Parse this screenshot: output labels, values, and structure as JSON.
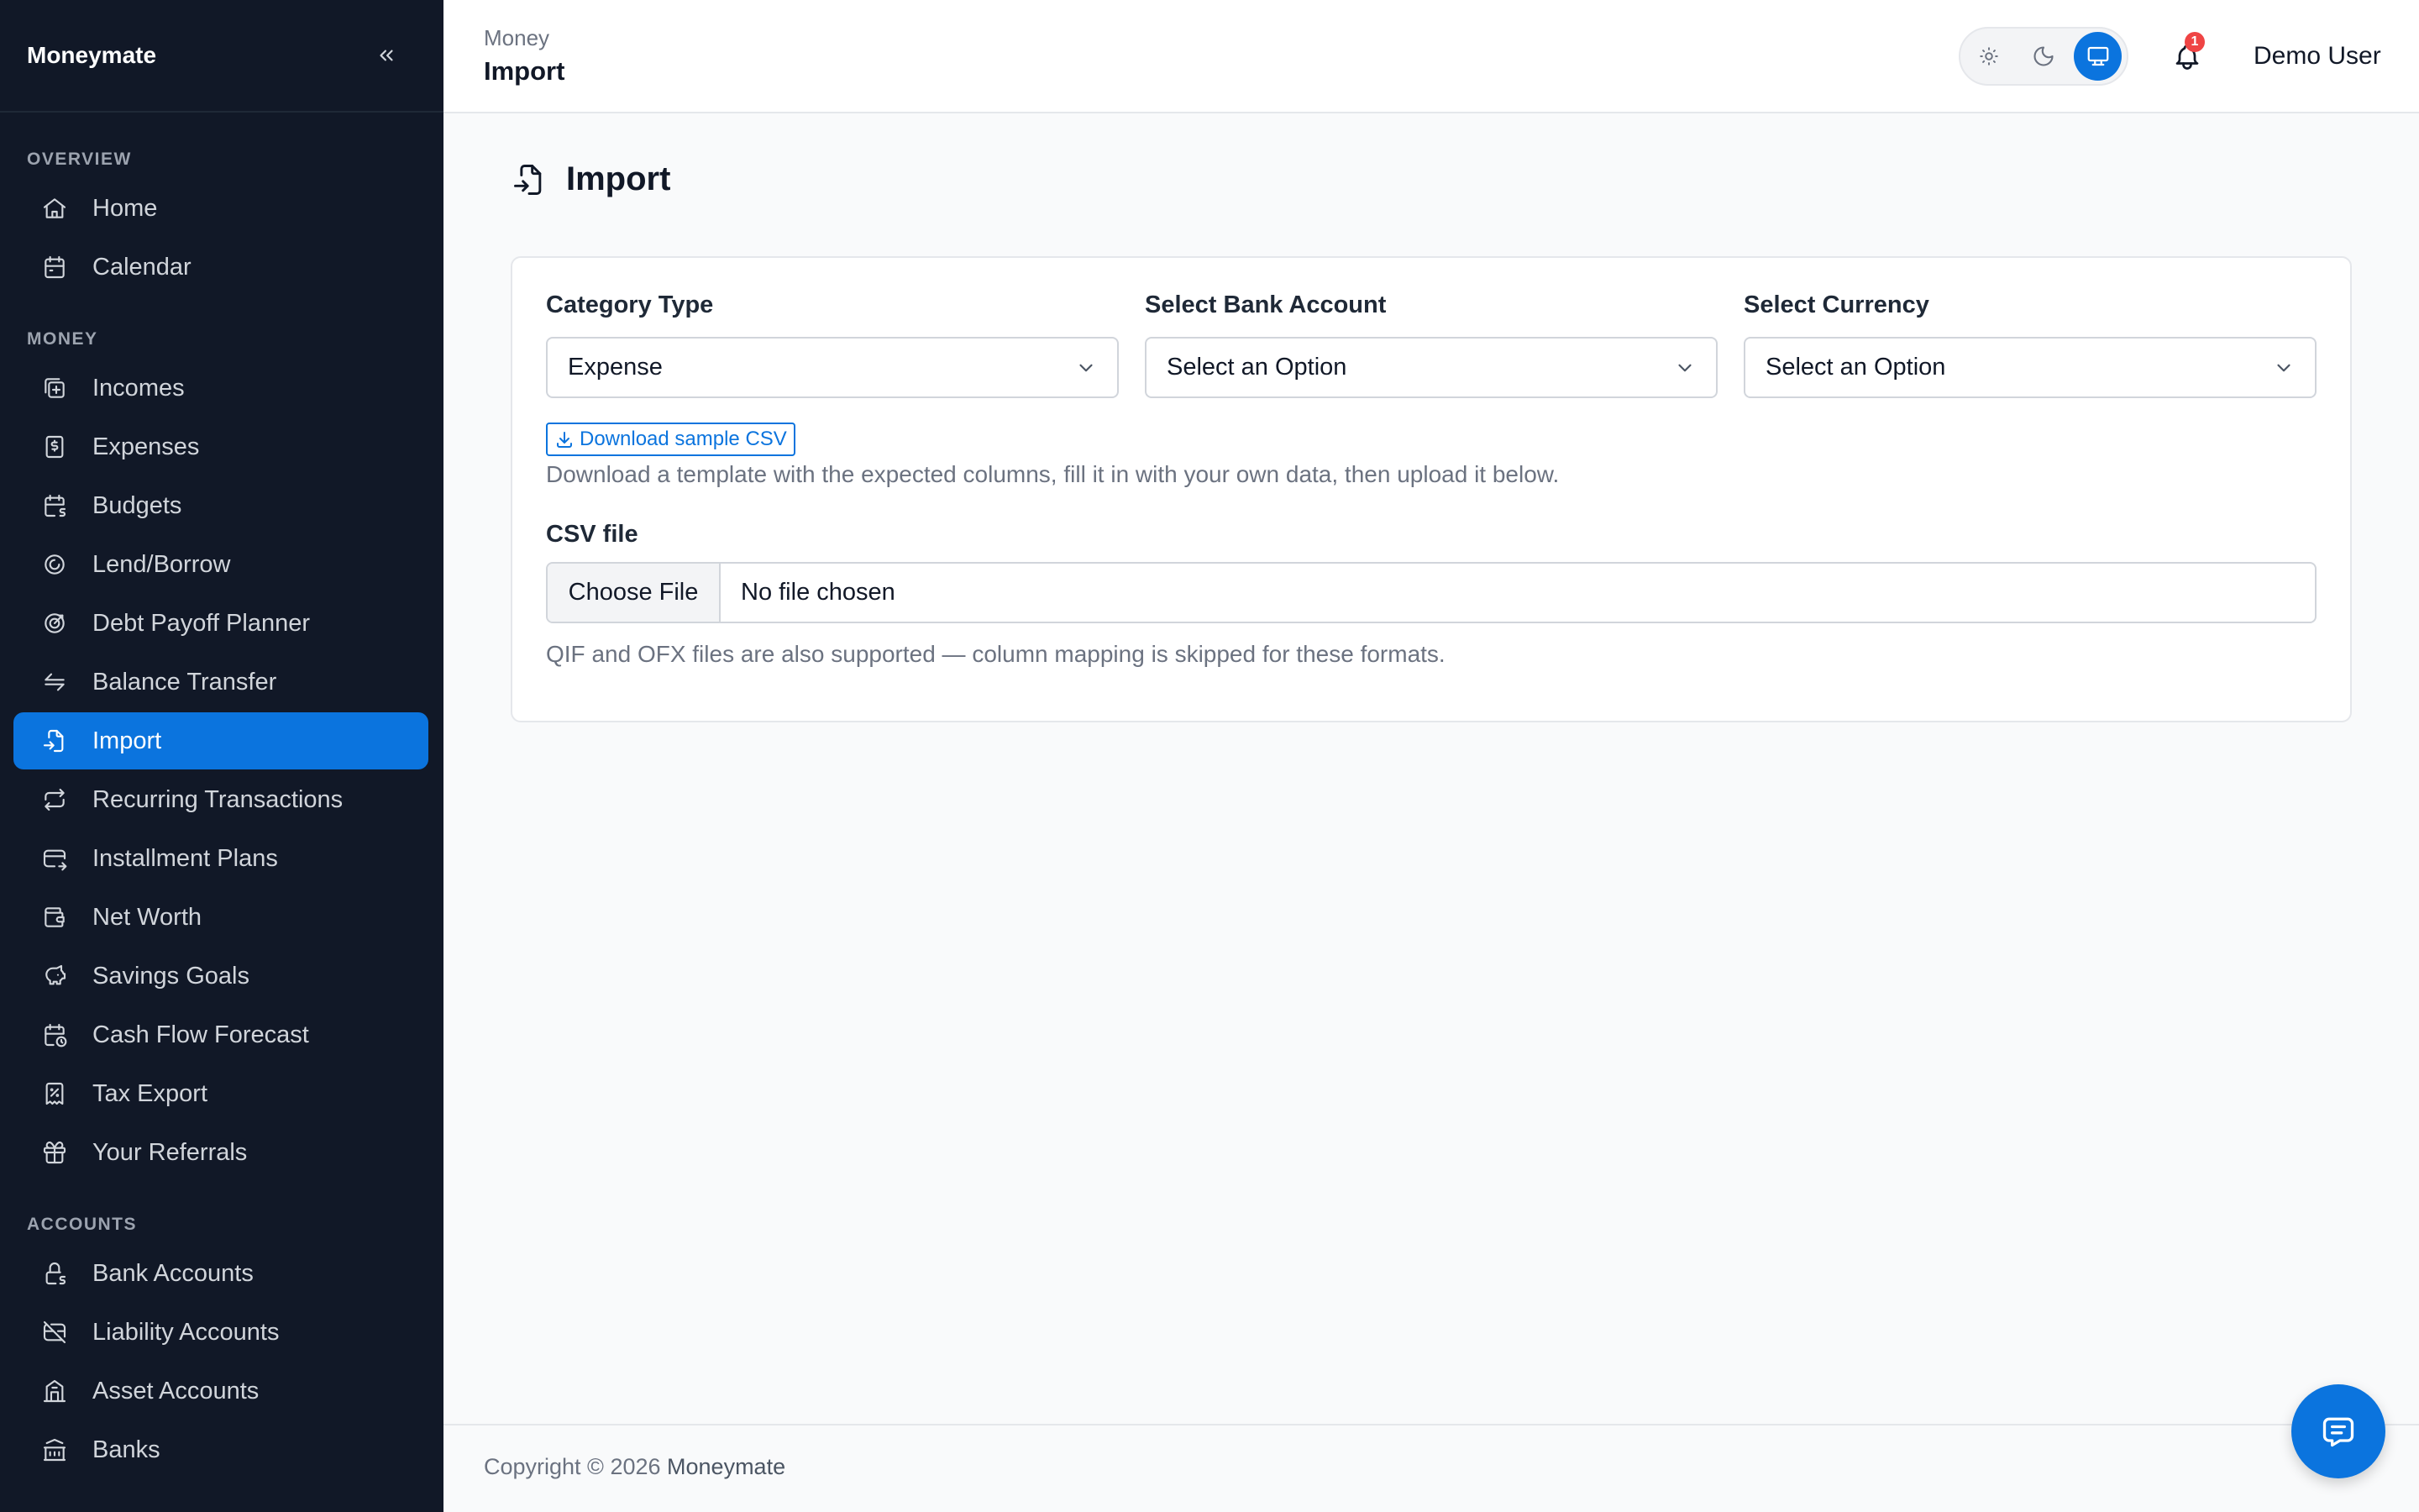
{
  "app": {
    "name": "Moneymate"
  },
  "sidebar": {
    "sections": [
      {
        "title": "OVERVIEW",
        "items": [
          {
            "label": "Home",
            "icon": "home-icon"
          },
          {
            "label": "Calendar",
            "icon": "calendar-icon"
          }
        ]
      },
      {
        "title": "MONEY",
        "items": [
          {
            "label": "Incomes",
            "icon": "income-icon"
          },
          {
            "label": "Expenses",
            "icon": "expense-icon"
          },
          {
            "label": "Budgets",
            "icon": "budget-icon"
          },
          {
            "label": "Lend/Borrow",
            "icon": "lend-borrow-icon"
          },
          {
            "label": "Debt Payoff Planner",
            "icon": "target-icon"
          },
          {
            "label": "Balance Transfer",
            "icon": "transfer-icon"
          },
          {
            "label": "Import",
            "icon": "import-icon",
            "active": true
          },
          {
            "label": "Recurring Transactions",
            "icon": "repeat-icon"
          },
          {
            "label": "Installment Plans",
            "icon": "card-icon"
          },
          {
            "label": "Net Worth",
            "icon": "wallet-icon"
          },
          {
            "label": "Savings Goals",
            "icon": "piggy-bank-icon"
          },
          {
            "label": "Cash Flow Forecast",
            "icon": "calendar-clock-icon"
          },
          {
            "label": "Tax Export",
            "icon": "tax-icon"
          },
          {
            "label": "Your Referrals",
            "icon": "gift-icon"
          }
        ]
      },
      {
        "title": "ACCOUNTS",
        "items": [
          {
            "label": "Bank Accounts",
            "icon": "bank-lock-icon"
          },
          {
            "label": "Liability Accounts",
            "icon": "credit-card-off-icon"
          },
          {
            "label": "Asset Accounts",
            "icon": "building-icon"
          },
          {
            "label": "Banks",
            "icon": "bank-icon"
          }
        ]
      }
    ]
  },
  "header": {
    "breadcrumb_parent": "Money",
    "breadcrumb_current": "Import",
    "theme_modes": [
      "light",
      "dark",
      "system"
    ],
    "theme_selected": "system",
    "notifications_count": "1",
    "user_name": "Demo User"
  },
  "page": {
    "title": "Import",
    "fields": {
      "category_type": {
        "label": "Category Type",
        "value": "Expense"
      },
      "bank_account": {
        "label": "Select Bank Account",
        "value": "Select an Option"
      },
      "currency": {
        "label": "Select Currency",
        "value": "Select an Option"
      }
    },
    "download_label": "Download sample CSV",
    "download_help": "Download a template with the expected columns, fill it in with your own data, then upload it below.",
    "csv_label": "CSV file",
    "file_button": "Choose File",
    "file_status": "No file chosen",
    "file_help": "QIF and OFX files are also supported — column mapping is skipped for these formats."
  },
  "footer": {
    "copyright": "Copyright © 2026",
    "brand": "Moneymate"
  },
  "colors": {
    "sidebar_bg": "#111827",
    "accent": "#0b74de",
    "badge": "#ef4444"
  }
}
